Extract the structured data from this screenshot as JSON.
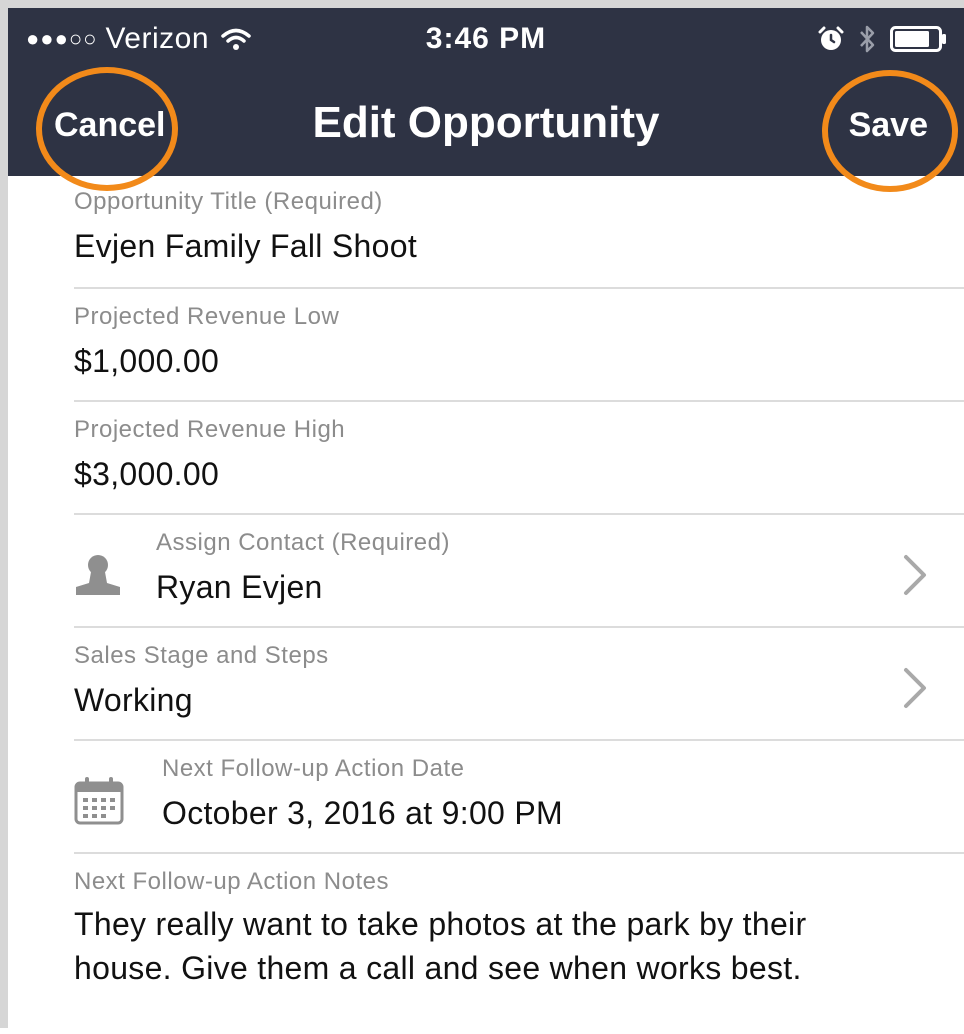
{
  "status_bar": {
    "signal": "●●●○○",
    "carrier": "Verizon",
    "time": "3:46 PM"
  },
  "nav": {
    "title": "Edit Opportunity",
    "cancel_label": "Cancel",
    "save_label": "Save"
  },
  "form": {
    "opportunity_title": {
      "label": "Opportunity Title (Required)",
      "value": "Evjen Family Fall Shoot"
    },
    "revenue_low": {
      "label": "Projected Revenue Low",
      "value": "$1,000.00"
    },
    "revenue_high": {
      "label": "Projected Revenue High",
      "value": "$3,000.00"
    },
    "contact": {
      "label": "Assign Contact (Required)",
      "value": "Ryan Evjen",
      "icon": "person-icon"
    },
    "sales_stage": {
      "label": "Sales Stage and Steps",
      "value": "Working"
    },
    "follow_up_date": {
      "label": "Next Follow-up Action Date",
      "value": "October 3, 2016 at 9:00 PM",
      "icon": "calendar-icon"
    },
    "follow_up_notes": {
      "label": "Next Follow-up Action Notes",
      "value": "They really want to take photos at the park by their house. Give them a call and see when works best."
    }
  },
  "colors": {
    "header_bg": "#2e3344",
    "highlight_ring": "#f28a1a",
    "label_text": "#8c8c8c",
    "divider": "#dcdcdc"
  }
}
